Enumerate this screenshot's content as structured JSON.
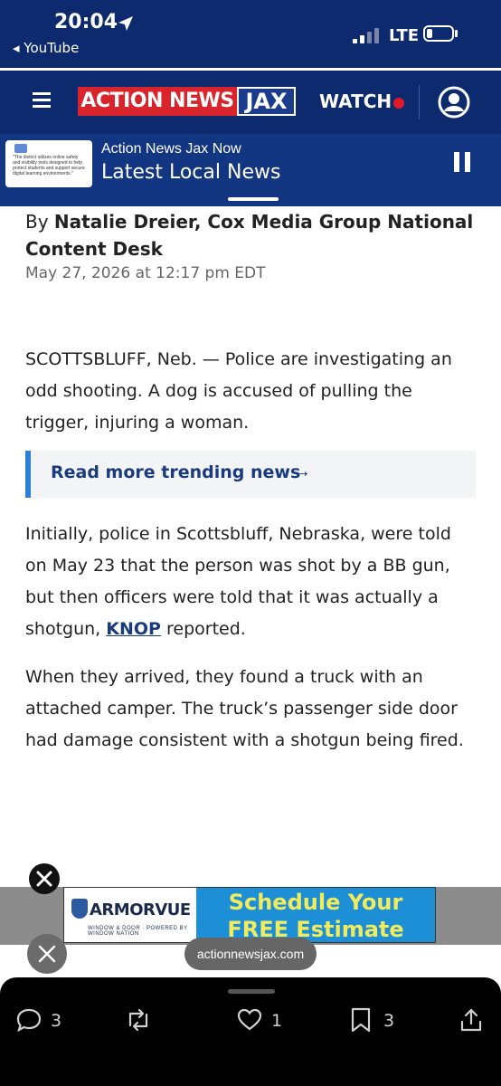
{
  "status_bar": {
    "time": "20:04",
    "back_app": "◂ YouTube",
    "network": "LTE"
  },
  "header": {
    "logo_main": "ACTION NEWS",
    "logo_accent": "JAX",
    "watch_label": "WATCH"
  },
  "live_banner": {
    "thumbnail_text": "\"The district utilizes online safety and visibility tools designed to help protect students and support secure digital learning environments.\"",
    "subtitle": "Action News Jax Now",
    "title": "Latest Local News"
  },
  "article": {
    "byline_prefix": "By",
    "author": "Natalie Dreier, Cox Media Group National Content Desk",
    "date": "May 27, 2026 at 12:17 pm EDT",
    "paragraph1": "SCOTTSBLUFF, Neb. — Police are investigating an odd shooting. A dog is accused of pulling the trigger, injuring a woman.",
    "trending_label": "Read more trending news",
    "trending_arrow": "→",
    "paragraph2_before": "Initially, police in Scottsbluff, Nebraska, were told on May 23 that the person was shot by a BB gun, but then officers were told that it was actually a shotgun,",
    "paragraph2_link": "KNOP",
    "paragraph2_after": "reported.",
    "paragraph3": "When they arrived, they found a truck with an attached camper. The truck’s passenger side door had damage consistent with a shotgun being fired."
  },
  "ad": {
    "brand": "ARMORVUE",
    "tagline": "WINDOW & DOOR · POWERED BY WINDOW NATION",
    "headline1": "Schedule Your",
    "headline2": "FREE Estimate"
  },
  "overlay": {
    "url": "actionnewsjax.com"
  },
  "toolbar": {
    "reply_count": "3",
    "retweet_count": "",
    "like_count": "1",
    "bookmark_count": "3"
  },
  "colors": {
    "navy": "#0d2a6e",
    "red": "#d9242b",
    "link": "#1a3b7d",
    "accent_bar": "#2e7fd8"
  }
}
